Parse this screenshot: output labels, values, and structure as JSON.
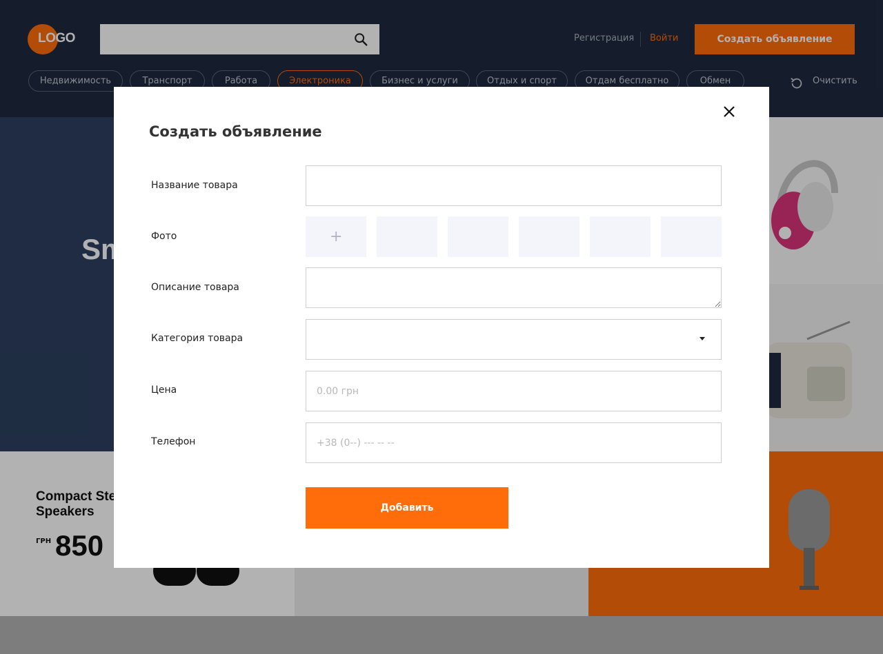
{
  "header": {
    "logo": "LOGO",
    "search": {
      "value": "",
      "placeholder": ""
    },
    "register_label": "Регистрация",
    "login_label": "Войти",
    "create_ad_label": "Создать объявление",
    "categories": [
      "Недвижимость",
      "Транспорт",
      "Работа",
      "Электроника",
      "Бизнес и услуги",
      "Отдых и спорт",
      "Отдам бесплатно",
      "Обмен"
    ],
    "active_category": "Электроника",
    "clear_label": "Очистить"
  },
  "background": {
    "hero_title": "Sm",
    "card1_title": "Compact Ste Speakers",
    "card1_currency": "ГРН",
    "card1_price": "850"
  },
  "modal": {
    "title": "Создать объявление",
    "fields": {
      "name_label": "Название товара",
      "photo_label": "Фото",
      "description_label": "Описание товара",
      "category_label": "Категория товара",
      "price_label": "Цена",
      "price_placeholder": "0.00 грн",
      "phone_label": "Телефон",
      "phone_placeholder": "+38 (0--) --- -- --"
    },
    "photo_add_glyph": "+",
    "submit_label": "Добавить"
  },
  "colors": {
    "accent": "#ff6d0a",
    "header_bg": "#1f2a3f",
    "photo_slot": "#f4f5fa"
  }
}
